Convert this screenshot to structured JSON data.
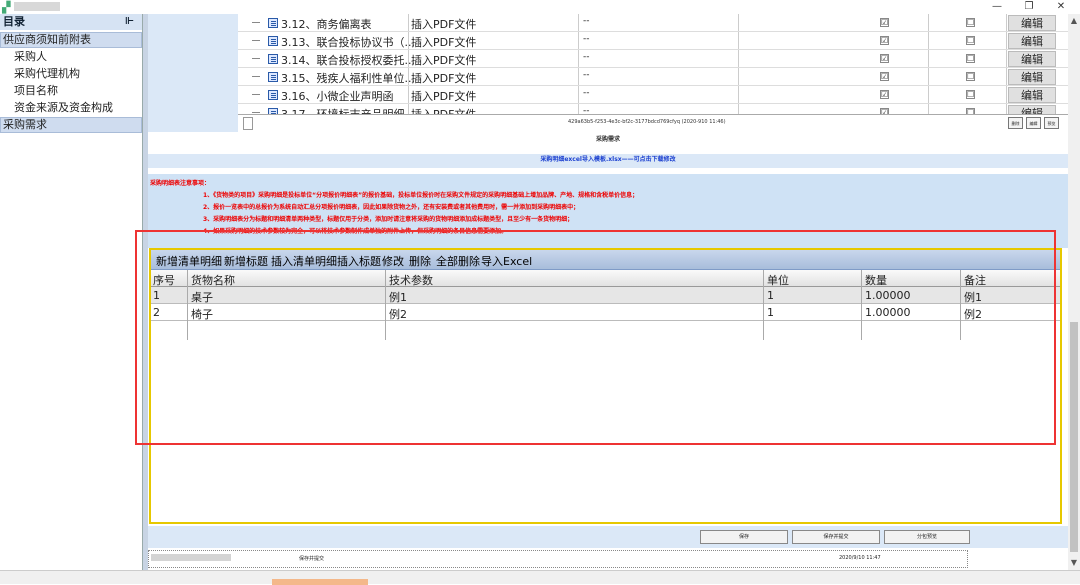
{
  "titlebar": {
    "restore_icon": "restore-icon",
    "close_icon": "close-icon"
  },
  "sidebar": {
    "header": "目录",
    "pin": "⊩",
    "category": "供应商须知前附表",
    "items": [
      {
        "label": "采购人"
      },
      {
        "label": "采购代理机构"
      },
      {
        "label": "项目名称"
      },
      {
        "label": "资金来源及资金构成"
      }
    ],
    "category2": "采购需求"
  },
  "attachments": {
    "rows": [
      {
        "name": "3.12、商务偏离表",
        "type": "插入PDF文件",
        "dash": "--",
        "checked1": "☑",
        "checked2": "☐",
        "edit": "编辑"
      },
      {
        "name": "3.13、联合投标协议书（...",
        "type": "插入PDF文件",
        "dash": "--",
        "checked1": "☑",
        "checked2": "☐",
        "edit": "编辑"
      },
      {
        "name": "3.14、联合投标授权委托...",
        "type": "插入PDF文件",
        "dash": "--",
        "checked1": "☑",
        "checked2": "☐",
        "edit": "编辑"
      },
      {
        "name": "3.15、残疾人福利性单位...",
        "type": "插入PDF文件",
        "dash": "--",
        "checked1": "☑",
        "checked2": "☐",
        "edit": "编辑"
      },
      {
        "name": "3.16、小微企业声明函",
        "type": "插入PDF文件",
        "dash": "--",
        "checked1": "☑",
        "checked2": "☐",
        "edit": "编辑"
      },
      {
        "name": "3.17、环境标志产品明细...",
        "type": "插入PDF文件",
        "dash": "--",
        "checked1": "☑",
        "checked2": "☐",
        "edit": "编辑"
      }
    ],
    "footer_uuid": "429a63b5-f253-4e3c-bf2c-3177bdcd769cfyq (2020-910 11:46)",
    "footer_btns": [
      "删除",
      "编辑",
      "预览"
    ]
  },
  "section": {
    "title": "采购需求",
    "import_link": "采购明细excel导入模板.xlsx——可点击下载修改",
    "notes_header": "采购明细表注意事项：",
    "notes": [
      "1、《货物类的项目》采购明细是投标单位“分项报价明细表”的报价基础，投标单位报价时在采购文件规定的采购明细基础上增加品牌、产地、规格和含税单价信息；",
      "2、报价一览表中的总报价为系统自动汇总分项报价明细表，因此如果除货物之外，还有安装费或者其他费用时，需一并添加到采购明细表中；",
      "3、采购明细表分为标题和明细清单两种类型，标题仅用于分类，添加时请注意将采购的货物明细添加成标题类型，且至少有一条货物明细；",
      "4、如果采购明细的技术参数较为完全，可以将技术参数制作成单独的附件上传，但采购明细的条目信息需要添加。"
    ]
  },
  "grid": {
    "toolbar": [
      "新增清单明细",
      "新增标题",
      "插入清单明细",
      "插入标题",
      "修改",
      "删除",
      "全部删除",
      "导入Excel"
    ],
    "columns": [
      "序号",
      "货物名称",
      "技术参数",
      "单位",
      "数量",
      "备注"
    ],
    "rows": [
      {
        "no": "1",
        "name": "桌子",
        "spec": "例1",
        "unit": "1",
        "qty": "1.00000",
        "note": "例1"
      },
      {
        "no": "2",
        "name": "椅子",
        "spec": "例2",
        "unit": "1",
        "qty": "1.00000",
        "note": "例2"
      }
    ]
  },
  "bottom": {
    "buttons": [
      "保存",
      "保存并提交",
      "分包预览"
    ],
    "label": "保存并提交",
    "timestamp": "2020/9/10 11:47"
  },
  "colors": {
    "accent": "#1a3fd0",
    "warning": "#e00000",
    "highlight": "#e6c800",
    "annotation": "#e33333"
  }
}
